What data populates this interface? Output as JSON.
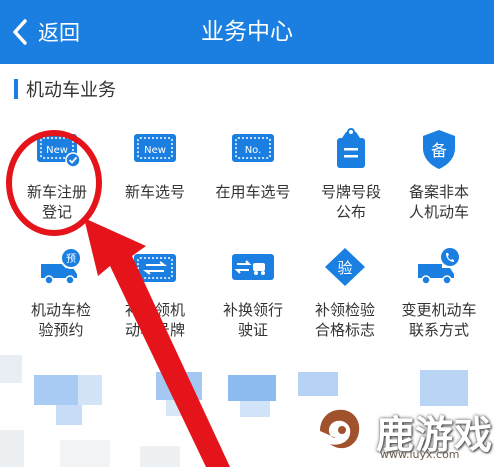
{
  "nav": {
    "back_label": "返回",
    "title": "业务中心"
  },
  "section": {
    "title": "机动车业务"
  },
  "items": [
    {
      "line1": "新车注册",
      "line2": "登记",
      "icon": "new-plate-icon"
    },
    {
      "line1": "新车选号",
      "line2": "",
      "icon": "new-plate-icon"
    },
    {
      "line1": "在用车选号",
      "line2": "",
      "icon": "plate-number-icon"
    },
    {
      "line1": "号牌号段",
      "line2": "公布",
      "icon": "tag-icon"
    },
    {
      "line1": "备案非本",
      "line2": "人机动车",
      "icon": "shield-icon"
    },
    {
      "line1": "机动车检",
      "line2": "验预约",
      "icon": "truck-booking-icon"
    },
    {
      "line1": "补换领机",
      "line2": "动车号牌",
      "icon": "swap-plate-icon"
    },
    {
      "line1": "补换领行",
      "line2": "驶证",
      "icon": "swap-license-icon"
    },
    {
      "line1": "补领检验",
      "line2": "合格标志",
      "icon": "inspection-mark-icon"
    },
    {
      "line1": "变更机动车",
      "line2": "联系方式",
      "icon": "truck-phone-icon"
    }
  ],
  "watermark": {
    "text": "鹿游戏",
    "sub": "www.luyx.com"
  },
  "colors": {
    "primary": "#1a7fe0",
    "annotation": "#e4141a"
  }
}
